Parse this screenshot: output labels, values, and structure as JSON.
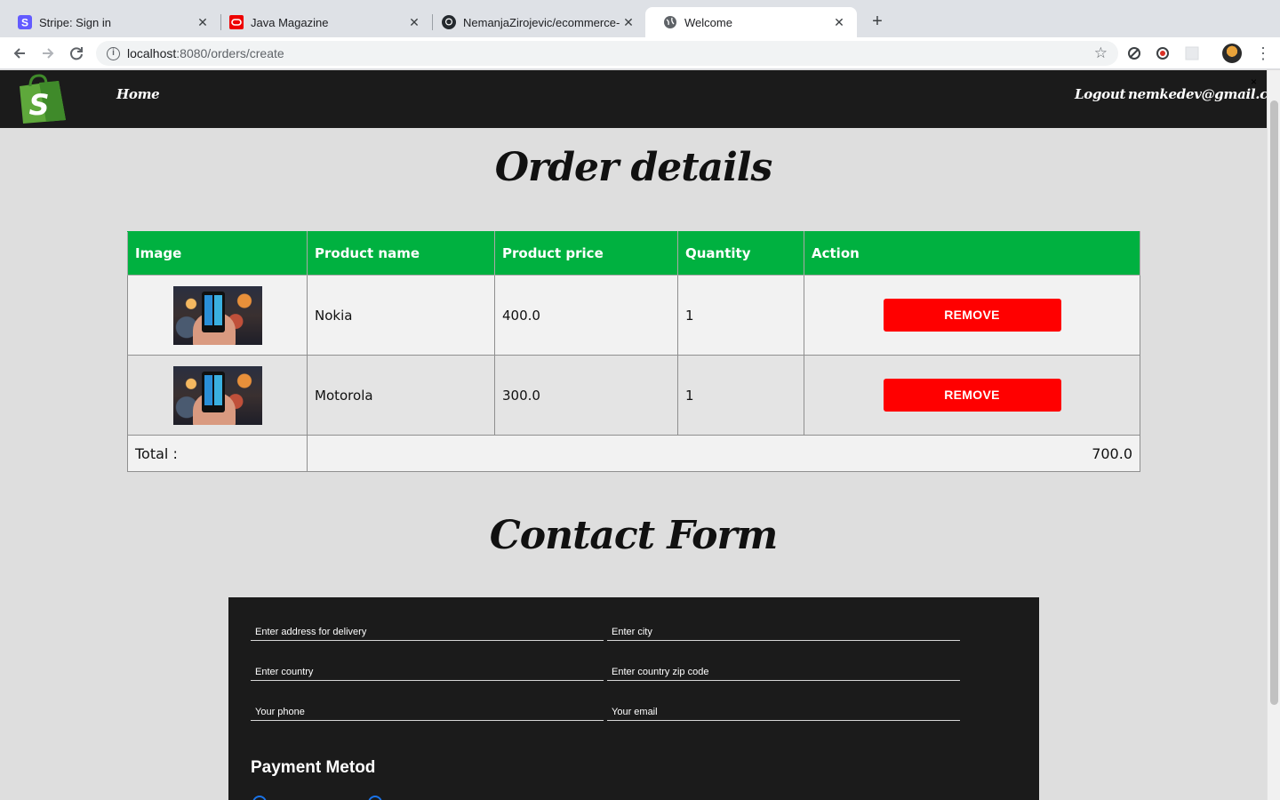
{
  "browser": {
    "tabs": [
      {
        "title": "Stripe: Sign in",
        "icon": "stripe-icon",
        "active": false
      },
      {
        "title": "Java Magazine",
        "icon": "oracle-icon",
        "active": false
      },
      {
        "title": "NemanjaZirojevic/ecommerce-",
        "icon": "github-icon",
        "active": false
      },
      {
        "title": "Welcome",
        "icon": "globe-icon",
        "active": true
      }
    ],
    "url_host": "localhost",
    "url_path": ":8080/orders/create"
  },
  "nav": {
    "home": "Home",
    "logout": "Logout",
    "user_email": "nemkedev@gmail.com",
    "close": "×"
  },
  "order": {
    "heading": "Order details",
    "columns": [
      "Image",
      "Product name",
      "Product price",
      "Quantity",
      "Action"
    ],
    "rows": [
      {
        "name": "Nokia",
        "price": "400.0",
        "quantity": "1",
        "action": "REMOVE"
      },
      {
        "name": "Motorola",
        "price": "300.0",
        "quantity": "1",
        "action": "REMOVE"
      }
    ],
    "total_label": "Total :",
    "total_value": "700.0"
  },
  "contact": {
    "heading": "Contact Form",
    "address_placeholder": "Enter address for delivery",
    "city_placeholder": "Enter city",
    "country_placeholder": "Enter country",
    "zip_placeholder": "Enter country zip code",
    "phone_placeholder": "Your phone",
    "email_placeholder": "Your email",
    "payment_title": "Payment Metod"
  },
  "colors": {
    "header_green": "#00b140",
    "remove_red": "#ff0000",
    "nav_dark": "#1b1b1b"
  }
}
